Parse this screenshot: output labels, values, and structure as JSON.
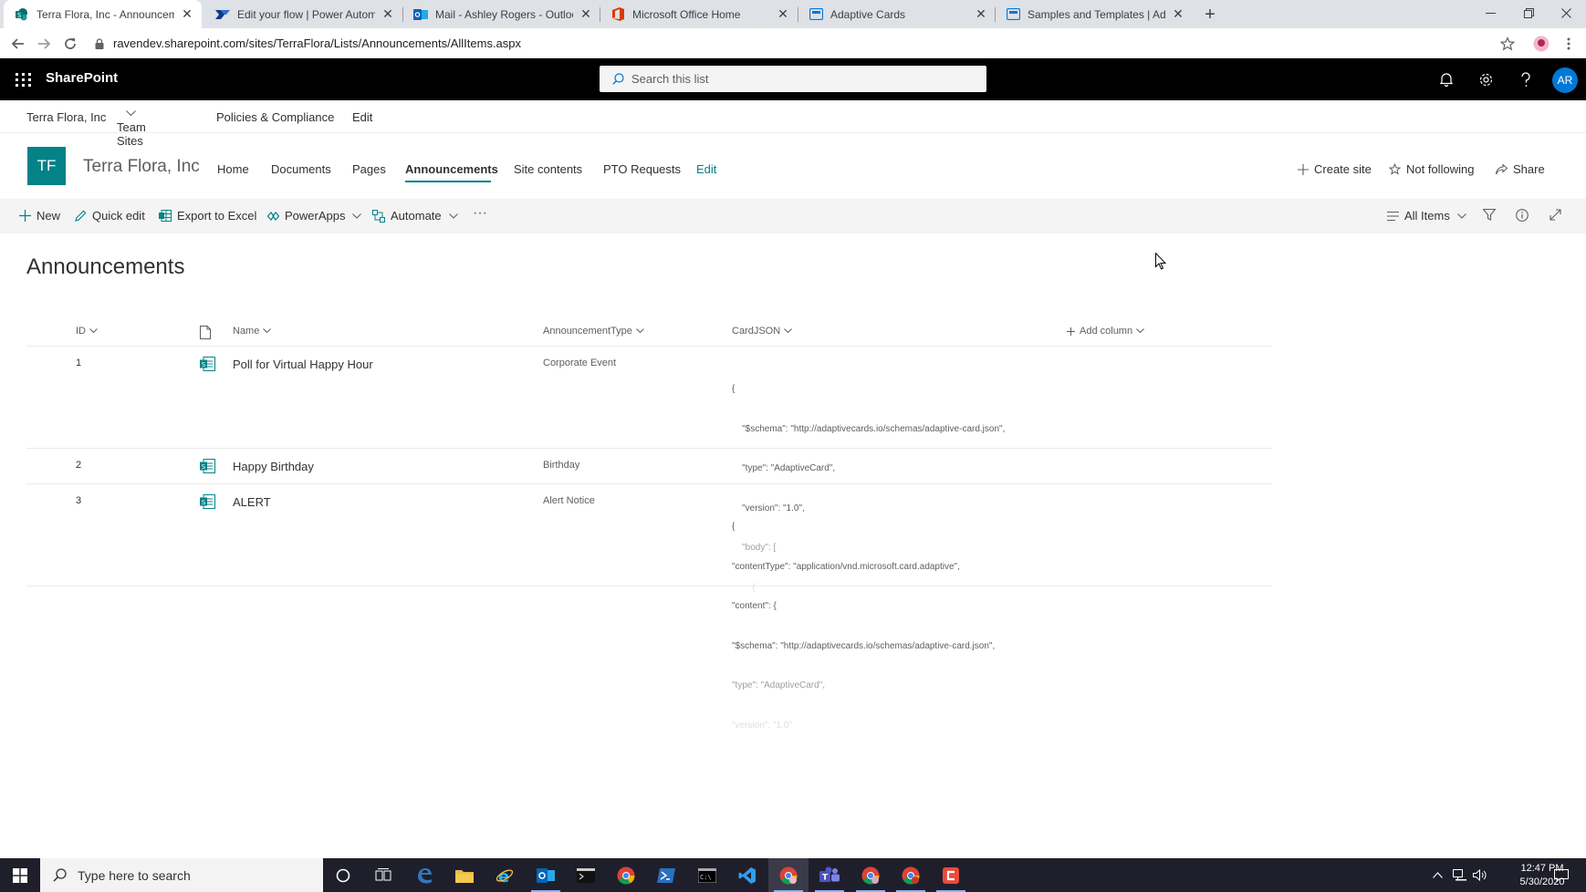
{
  "browser": {
    "tabs": [
      {
        "title": "Terra Flora, Inc - Announcements",
        "icon": "sharepoint-icon",
        "active": true
      },
      {
        "title": "Edit your flow | Power Automate",
        "icon": "power-automate-icon",
        "active": false
      },
      {
        "title": "Mail - Ashley Rogers - Outlook",
        "icon": "outlook-icon",
        "active": false
      },
      {
        "title": "Microsoft Office Home",
        "icon": "office-icon",
        "active": false
      },
      {
        "title": "Adaptive Cards",
        "icon": "adaptive-cards-icon",
        "active": false
      },
      {
        "title": "Samples and Templates | Adaptive Cards",
        "icon": "adaptive-cards-icon",
        "active": false
      }
    ],
    "url": "ravendev.sharepoint.com/sites/TerraFlora/Lists/Announcements/AllItems.aspx"
  },
  "suitebar": {
    "brand": "SharePoint",
    "search_placeholder": "Search this list",
    "avatar_initials": "AR"
  },
  "hubnav": {
    "items": [
      "Terra Flora, Inc",
      "Team Sites",
      "Policies & Compliance",
      "Edit"
    ]
  },
  "site": {
    "logo_text": "TF",
    "name": "Terra Flora, Inc",
    "nav": [
      "Home",
      "Documents",
      "Pages",
      "Announcements",
      "Site contents",
      "PTO Requests",
      "Edit"
    ],
    "current_nav": "Announcements",
    "actions": [
      "Create site",
      "Not following",
      "Share"
    ]
  },
  "commandbar": {
    "new": "New",
    "quick_edit": "Quick edit",
    "export": "Export to Excel",
    "powerapps": "PowerApps",
    "automate": "Automate",
    "more": "···",
    "view": "All Items"
  },
  "list": {
    "title": "Announcements",
    "columns": {
      "id": "ID",
      "name": "Name",
      "type": "AnnouncementType",
      "card": "CardJSON",
      "add": "Add column"
    },
    "rows": [
      {
        "id": "1",
        "name": "Poll for Virtual Happy Hour",
        "type": "Corporate Event",
        "json": [
          "{",
          "    \"$schema\": \"http://adaptivecards.io/schemas/adaptive-card.json\",",
          "    \"type\": \"AdaptiveCard\",",
          "    \"version\": \"1.0\",",
          "    \"body\": [",
          "        {"
        ]
      },
      {
        "id": "2",
        "name": "Happy Birthday",
        "type": "Birthday",
        "json": []
      },
      {
        "id": "3",
        "name": "ALERT",
        "type": "Alert Notice",
        "json": [
          "{",
          "\"contentType\": \"application/vnd.microsoft.card.adaptive\",",
          "\"content\": {",
          "\"$schema\": \"http://adaptivecards.io/schemas/adaptive-card.json\",",
          "\"type\": \"AdaptiveCard\",",
          "\"version\": \"1.0\""
        ]
      }
    ]
  },
  "taskbar": {
    "search_placeholder": "Type here to search",
    "time": "12:47 PM",
    "date": "5/30/2020"
  },
  "colors": {
    "theme": "#038387",
    "suitebar": "#000000",
    "avatar": "#0078d4"
  }
}
